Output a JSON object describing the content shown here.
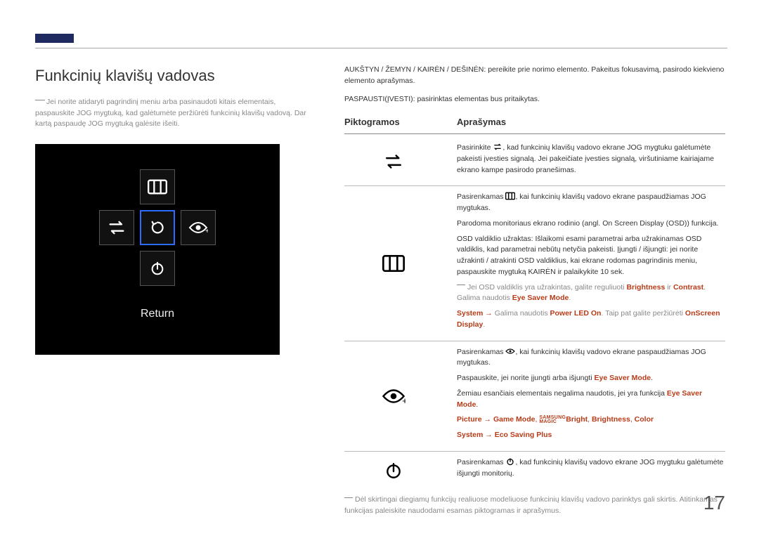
{
  "page_title": "Funkcinių klavišų vadovas",
  "intro": "Jei norite atidaryti pagrindinį meniu arba pasinaudoti kitais elementais, paspauskite JOG mygtuką, kad galėtumėte peržiūrėti funkcinių klavišų vadovą. Dar kartą paspaudę JOG mygtuką galėsite išeiti.",
  "osd": {
    "return": "Return"
  },
  "nav1": "AUKŠTYN / ŽEMYN / KAIRĖN / DEŠINĖN: pereikite prie norimo elemento. Pakeitus fokusavimą, pasirodo kiekvieno elemento aprašymas.",
  "nav2": "PASPAUSTI(ĮVESTI): pasirinktas elementas bus pritaikytas.",
  "table_head": {
    "c1": "Piktogramos",
    "c2": "Aprašymas"
  },
  "rows": {
    "source": {
      "p1a": "Pasirinkite ",
      "p1b": ", kad funkcinių klavišų vadovo ekrane JOG mygtuku galėtumėte pakeisti įvesties signalą. Jei pakeičiate įvesties signalą, viršutiniame kairiajame ekrano kampe pasirodo pranešimas."
    },
    "menu": {
      "p1a": "Pasirenkamas ",
      "p1b": ", kai funkcinių klavišų vadovo ekrane paspaudžiamas JOG mygtukas.",
      "p2": "Parodoma monitoriaus ekrano rodinio (angl. On Screen Display (OSD)) funkcija.",
      "p3": "OSD valdiklio užraktas: Išlaikomi esami parametrai arba užrakinamas OSD valdiklis, kad parametrai nebūtų netyčia pakeisti. Įjungti / išjungti: jei norite užrakinti / atrakinti OSD valdiklius, kai ekrane rodomas pagrindinis meniu, paspauskite mygtuką KAIRĖN ir palaikykite 10 sek.",
      "note1a": "Jei OSD valdiklis yra užrakintas, galite reguliuoti ",
      "note1_b": "Brightness",
      "note1_c": " ir ",
      "note1_d": "Contrast",
      "note1_e": ". Galima naudotis ",
      "note1_f": "Eye Saver Mode",
      "note1_g": ".",
      "note2_a": "System",
      "note2_b": " → ",
      "note2_c": "Galima naudotis ",
      "note2_d": "Power LED On",
      "note2_e": ". Taip pat galite peržiūrėti ",
      "note2_f": "OnScreen Display",
      "note2_g": "."
    },
    "eye": {
      "p1a": "Pasirenkamas ",
      "p1b": ", kai funkcinių klavišų vadovo ekrane paspaudžiamas JOG mygtukas.",
      "p2a": "Paspauskite, jei norite įjungti arba išjungti ",
      "p2b": "Eye Saver Mode",
      "p2c": ".",
      "p3a": "Žemiau esančiais elementais negalima naudotis, jei yra funkcija ",
      "p3b": "Eye Saver Mode",
      "p3c": ".",
      "p4_a": "Picture",
      "p4_b": " → ",
      "p4_c": "Game Mode",
      "p4_d": ", ",
      "p4_magic_sup": "SAMSUNG",
      "p4_magic_sub": "MAGIC",
      "p4_e": "Bright",
      "p4_f": ", ",
      "p4_g": "Brightness",
      "p4_h": ", ",
      "p4_i": "Color",
      "p5_a": "System",
      "p5_b": " → ",
      "p5_c": "Eco Saving Plus"
    },
    "power": {
      "p1a": "Pasirenkamas ",
      "p1b": ", kad funkcinių klavišų vadovo ekrane JOG mygtuku galėtumėte išjungti monitorių."
    }
  },
  "footnote": "Dėl skirtingai diegiamų funkcijų realiuose modeliuose funkcinių klavišų vadovo parinktys gali skirtis. Atitinkamas funkcijas paleiskite naudodami esamas piktogramas ir aprašymus.",
  "page_number": "17"
}
